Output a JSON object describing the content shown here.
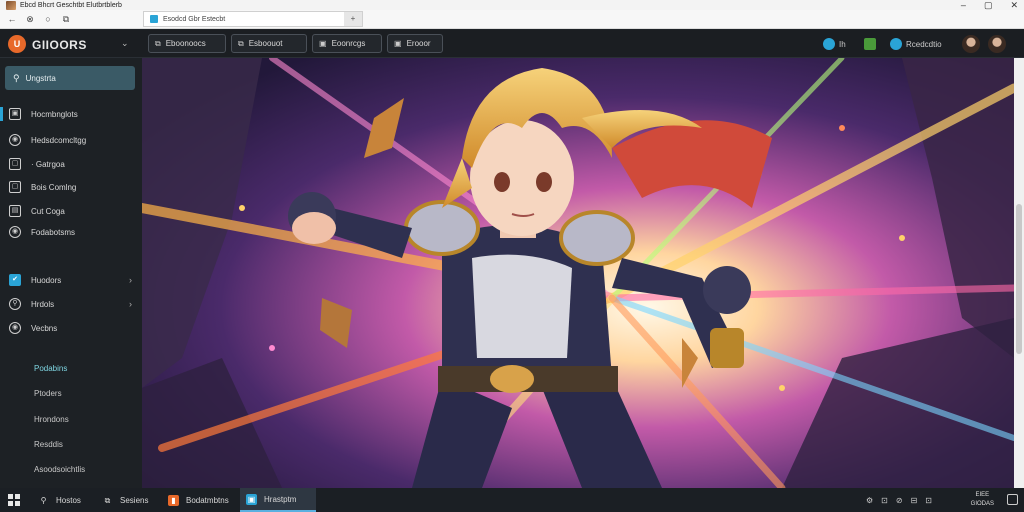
{
  "window": {
    "title": "Ebcd Bhcrt Geschtbt Elutbrtblerb",
    "controls": [
      "–",
      "▢",
      "✕"
    ]
  },
  "browser": {
    "nav": [
      "←",
      "⊗",
      "○",
      "⧉"
    ],
    "tab_label": "Esodcd Gbr Estecbt",
    "tab_close": "+"
  },
  "app": {
    "logo_letter": "U",
    "brand": "GIIOORS",
    "brand_chevron": "⌄",
    "top_buttons": [
      {
        "icon": "⧉",
        "label": "Eboonoocs"
      },
      {
        "icon": "⧉",
        "label": "Esboouot"
      },
      {
        "icon": "▣",
        "label": "Eoonrcgs"
      },
      {
        "icon": "▣",
        "label": "Erooor"
      }
    ],
    "status": [
      {
        "label": "Ih",
        "color": "#2aa4d6"
      },
      {
        "label": "",
        "color": "#4a9a3a"
      },
      {
        "label": "Rcedcdtio",
        "color": "#2aa4d6"
      }
    ]
  },
  "sidebar": {
    "search_label": "Ungstrta",
    "items": [
      {
        "label": "Hocmbnglots",
        "icon": "▣",
        "active": true
      },
      {
        "label": "Hedsdcomcltgg",
        "icon": "◉",
        "active": false
      },
      {
        "label": "· Gatrgoa",
        "icon": "▢",
        "active": false
      },
      {
        "label": "Bois Comlng",
        "icon": "▢",
        "active": false
      },
      {
        "label": "Cut Coga",
        "icon": "▤",
        "active": false
      },
      {
        "label": "Fodabotsms",
        "icon": "◉",
        "active": false
      },
      {
        "label": "Huodors",
        "icon": "✔",
        "active": false,
        "chevron": "›"
      },
      {
        "label": "Hrdols",
        "icon": "⚲",
        "active": false,
        "chevron": "›"
      },
      {
        "label": "Vecbns",
        "icon": "◉",
        "active": false
      }
    ],
    "subitems": [
      {
        "label": "Podabins",
        "highlight": true
      },
      {
        "label": "Ptoders",
        "highlight": false
      },
      {
        "label": "Hrondons",
        "highlight": false
      },
      {
        "label": "Resddis",
        "highlight": false
      },
      {
        "label": "Asoodsoichtlis",
        "highlight": false
      }
    ]
  },
  "taskbar": {
    "items": [
      {
        "icon": "⚲",
        "label": "Hostos",
        "color": "#1b1f24",
        "active": false
      },
      {
        "icon": "⧉",
        "label": "Sesiens",
        "color": "#1b1f24",
        "active": false
      },
      {
        "icon": "▮",
        "label": "Bodatmbtns",
        "color": "#e8692a",
        "active": false
      },
      {
        "icon": "▣",
        "label": "Hrastptm",
        "color": "#2aa4d6",
        "active": true
      }
    ],
    "tray_icons": [
      "⚙",
      "⊡",
      "⊘",
      "⊟",
      "⊡"
    ],
    "clock_line1": "EIEE",
    "clock_line2": "GIODAS"
  }
}
